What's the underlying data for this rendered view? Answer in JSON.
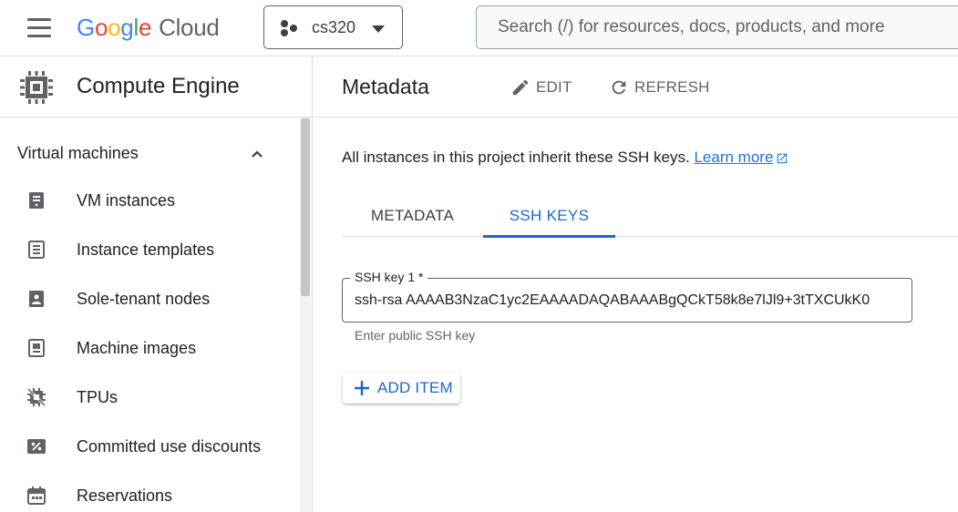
{
  "header": {
    "logo": {
      "google": [
        "G",
        "o",
        "o",
        "g",
        "l",
        "e"
      ],
      "product": "Cloud"
    },
    "project": "cs320",
    "search_placeholder": "Search (/) for resources, docs, products, and more"
  },
  "sidebar": {
    "title": "Compute Engine",
    "section": "Virtual machines",
    "items": [
      {
        "label": "VM instances",
        "icon": "vm-instances-icon"
      },
      {
        "label": "Instance templates",
        "icon": "instance-templates-icon"
      },
      {
        "label": "Sole-tenant nodes",
        "icon": "sole-tenant-nodes-icon"
      },
      {
        "label": "Machine images",
        "icon": "machine-images-icon"
      },
      {
        "label": "TPUs",
        "icon": "tpu-icon"
      },
      {
        "label": "Committed use discounts",
        "icon": "percent-icon"
      },
      {
        "label": "Reservations",
        "icon": "calendar-icon"
      }
    ]
  },
  "main": {
    "title": "Metadata",
    "edit_label": "EDIT",
    "refresh_label": "REFRESH",
    "info_text": "All instances in this project inherit these SSH keys.",
    "learn_more": "Learn more",
    "tabs": [
      {
        "label": "METADATA",
        "active": false
      },
      {
        "label": "SSH KEYS",
        "active": true
      }
    ],
    "ssh_field": {
      "label": "SSH key 1 *",
      "value": "ssh-rsa AAAAB3NzaC1yc2EAAAADAQABAAABgQCkT58k8e7lJl9+3tTXCUkK0",
      "hint": "Enter public SSH key"
    },
    "add_item_label": "ADD ITEM"
  },
  "colors": {
    "accent": "#1967d2",
    "link": "#1a73e8",
    "border": "#dadce0",
    "icon": "#5f6368"
  }
}
